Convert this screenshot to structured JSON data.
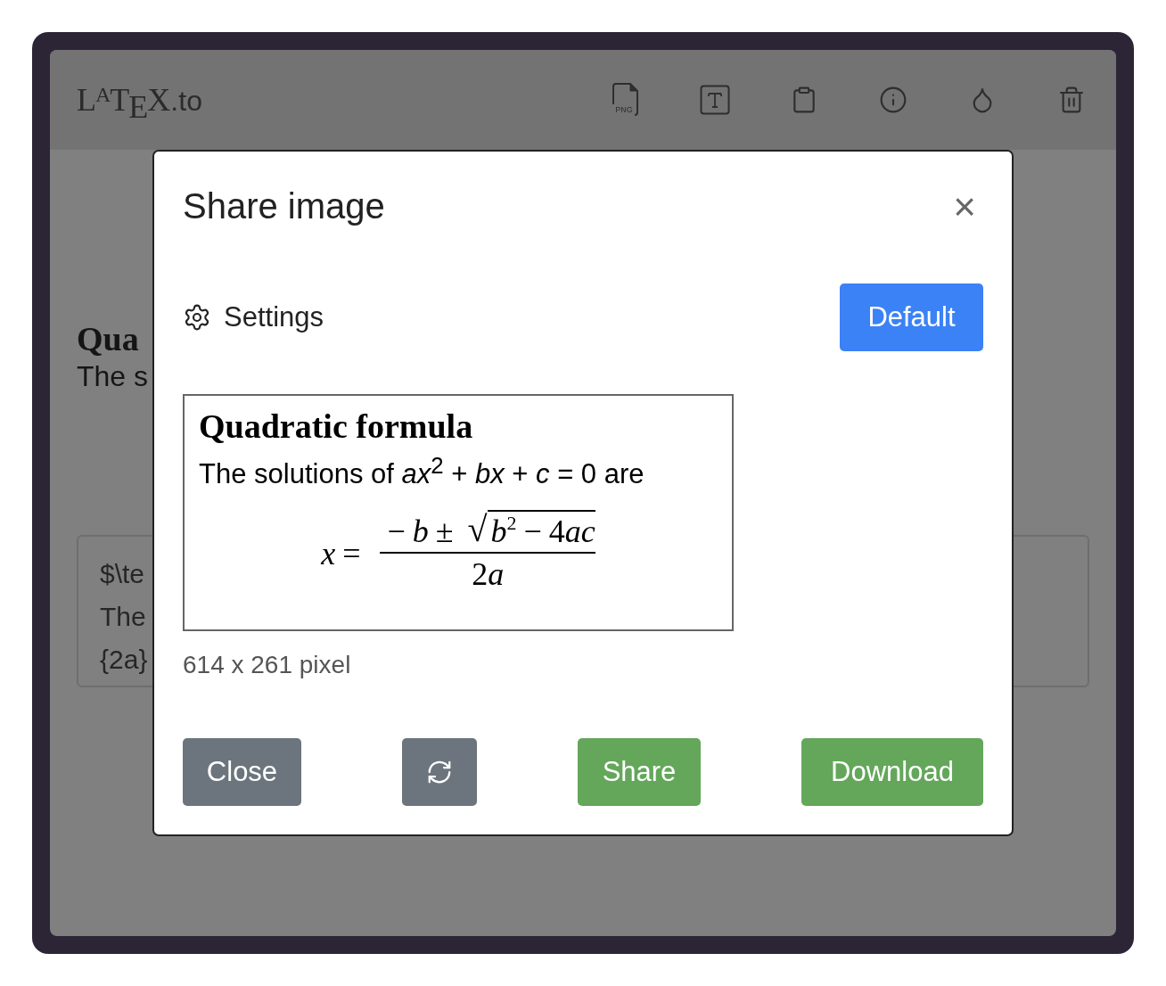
{
  "header": {
    "logo": [
      {
        "text": "L",
        "kind": "plain"
      },
      {
        "text": "A",
        "kind": "raised"
      },
      {
        "text": "T",
        "kind": "plain"
      },
      {
        "text": "E",
        "kind": "lowered"
      },
      {
        "text": "X",
        "kind": "plain"
      },
      {
        "text": ".to",
        "kind": "suffix"
      }
    ],
    "toolbar": [
      {
        "kind": "png",
        "label": "PNG"
      },
      {
        "kind": "text"
      },
      {
        "kind": "clipboard"
      },
      {
        "kind": "info"
      },
      {
        "kind": "theme"
      },
      {
        "kind": "trash"
      }
    ]
  },
  "document": {
    "heading": "Qua",
    "line": "The s"
  },
  "editor": {
    "lines": [
      "$\\te",
      "The",
      "{2a}"
    ]
  },
  "dialog": {
    "title": "Share image",
    "close": "×",
    "settings_label": "Settings",
    "default_button": "Default",
    "preview": {
      "heading": "Quadratic formula",
      "sentence": "The solutions of *ax*$^{2}$ + *bx* + *c* = 0 are",
      "lhs": [
        {
          "t": "x",
          "kind": "variable"
        },
        {
          "t": "=",
          "kind": "operator"
        }
      ],
      "numerator_prefix": [
        {
          "t": "−",
          "kind": "operator"
        },
        {
          "t": "b",
          "kind": "variable"
        },
        {
          "t": "±",
          "kind": "operator"
        }
      ],
      "radical": "√",
      "radicand": [
        {
          "t": "b",
          "kind": "variable"
        },
        {
          "t": "2",
          "kind": "superscript"
        },
        {
          "t": "−",
          "kind": "operator"
        },
        {
          "t": "4",
          "kind": "number"
        },
        {
          "t": "ac",
          "kind": "variable"
        }
      ],
      "denominator": [
        {
          "t": "2",
          "kind": "number"
        },
        {
          "t": "a",
          "kind": "variable"
        }
      ]
    },
    "size": "614 x 261 pixel",
    "buttons": [
      {
        "kind": "close",
        "label": "Close"
      },
      {
        "kind": "refresh"
      },
      {
        "kind": "share",
        "label": "Share"
      },
      {
        "kind": "download",
        "label": "Download"
      }
    ]
  }
}
